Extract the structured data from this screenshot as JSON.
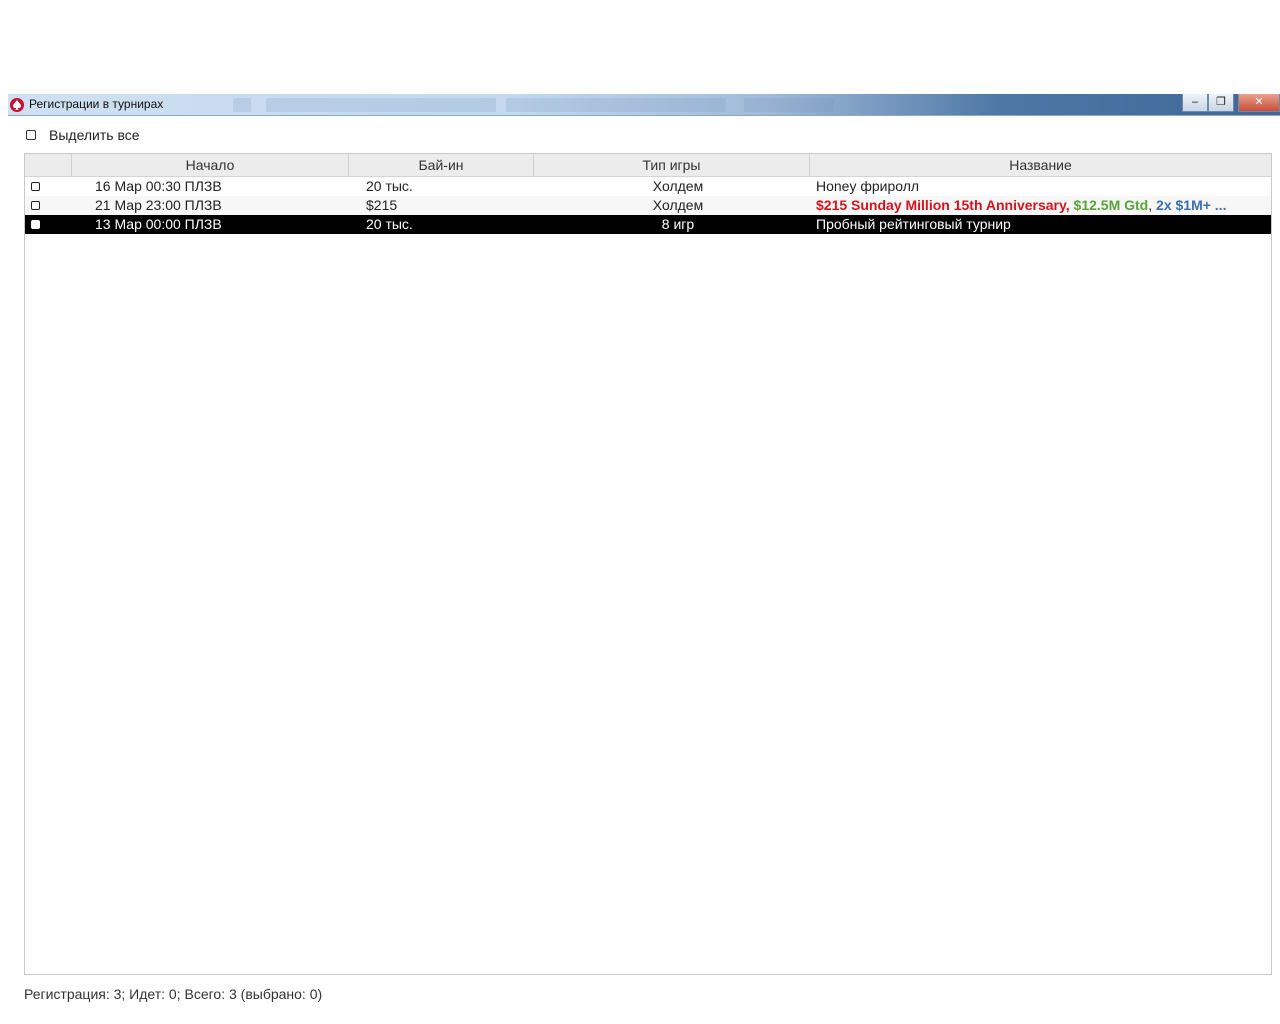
{
  "window": {
    "title": "Регистрации в турнирах",
    "icon": "pokerstars-spade-icon",
    "buttons": {
      "minimize": "‒",
      "restore": "❐",
      "close": "✕"
    }
  },
  "select_all": {
    "label": "Выделить все",
    "checked": false
  },
  "table": {
    "columns": [
      "Начало",
      "Бай-ин",
      "Тип игры",
      "Название"
    ],
    "rows": [
      {
        "start": "16 Мар  00:30 ПЛЗВ",
        "buyin": "20 тыс.",
        "game": "Холдем",
        "name_parts": [
          {
            "text": "Honey фриролл",
            "color": "default"
          }
        ],
        "checked": false,
        "selected": false
      },
      {
        "start": "21 Мар  23:00 ПЛЗВ",
        "buyin": "$215",
        "game": "Холдем",
        "name_parts": [
          {
            "text": "$215 Sunday Million 15th Anniversary",
            "color": "red"
          },
          {
            "text": ", ",
            "color": "red"
          },
          {
            "text": "$12.5M Gtd",
            "color": "green"
          },
          {
            "text": ", ",
            "color": "default"
          },
          {
            "text": "2x $1M+ ...",
            "color": "blue"
          }
        ],
        "checked": false,
        "selected": false
      },
      {
        "start": "13 Мар  00:00 ПЛЗВ",
        "buyin": "20 тыс.",
        "game": "8 игр",
        "name_parts": [
          {
            "text": "Пробный рейтинговый турнир",
            "color": "default"
          }
        ],
        "checked": true,
        "selected": true
      }
    ]
  },
  "status": "Регистрация: 3; Идет: 0; Всего: 3 (выбрано: 0)",
  "colors": {
    "selected_row": "#000000",
    "accent_red": "#d4141c",
    "accent_green": "#5aa436",
    "accent_blue": "#3a6fb0"
  }
}
